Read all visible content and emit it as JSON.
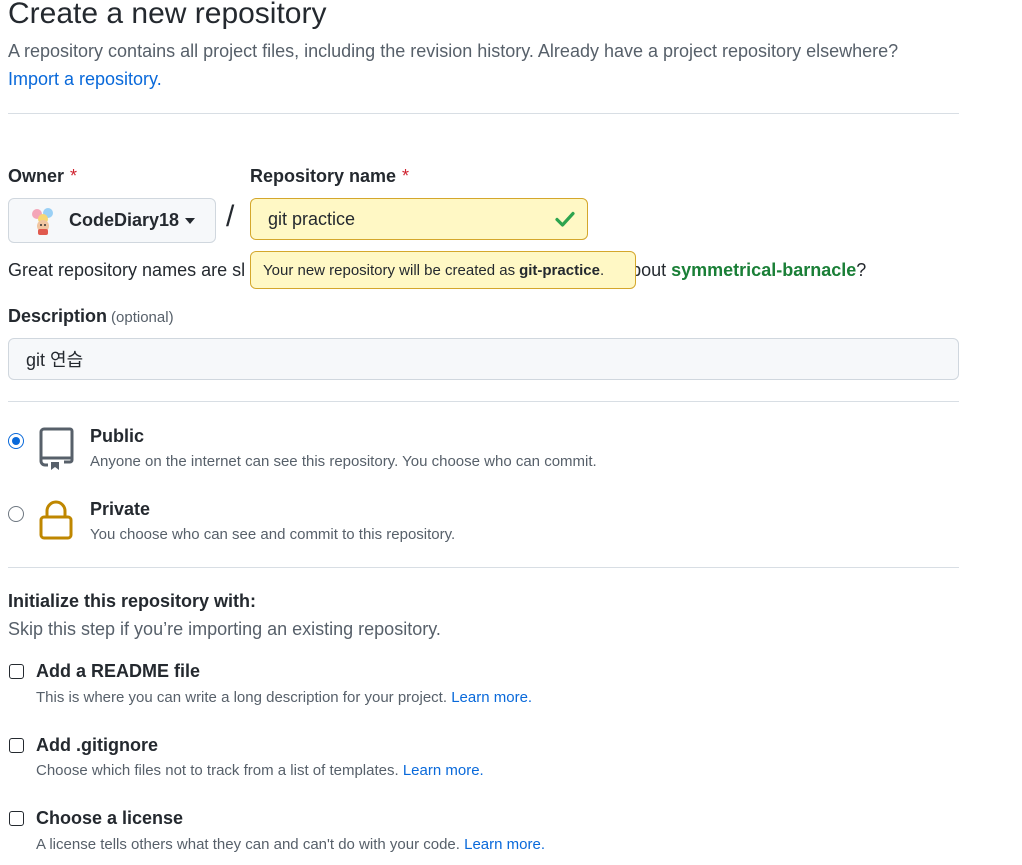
{
  "header": {
    "title": "Create a new repository",
    "subtitle": "A repository contains all project files, including the revision history. Already have a project repository elsewhere?",
    "import_link": "Import a repository."
  },
  "owner": {
    "label": "Owner",
    "required_mark": "*",
    "value": "CodeDiary18",
    "avatar_icon": "owner-avatar"
  },
  "separator": "/",
  "repo_name": {
    "label": "Repository name",
    "required_mark": "*",
    "value": "git practice",
    "status_icon": "check-icon",
    "status_color": "#2da44e"
  },
  "name_hint": {
    "prefix": "Great repository names are sl",
    "suffix": "bout ",
    "suggestion": "symmetrical-barnacle",
    "end": "?"
  },
  "tooltip": {
    "text": "Your new repository will be created as",
    "slug": "git-practice",
    "end": "."
  },
  "description": {
    "label": "Description",
    "optional": "(optional)",
    "value": "git 연습"
  },
  "visibility": {
    "options": [
      {
        "title": "Public",
        "desc": "Anyone on the internet can see this repository. You choose who can commit.",
        "selected": true,
        "icon": "repo-book-icon"
      },
      {
        "title": "Private",
        "desc": "You choose who can see and commit to this repository.",
        "selected": false,
        "icon": "lock-icon"
      }
    ]
  },
  "initialize": {
    "title": "Initialize this repository with:",
    "subtitle": "Skip this step if you’re importing an existing repository.",
    "options": [
      {
        "title": "Add a README file",
        "desc": "This is where you can write a long description for your project.",
        "link": "Learn more.",
        "checked": false
      },
      {
        "title": "Add .gitignore",
        "desc": "Choose which files not to track from a list of templates.",
        "link": "Learn more.",
        "checked": false
      },
      {
        "title": "Choose a license",
        "desc": "A license tells others what they can and can't do with your code.",
        "link": "Learn more.",
        "checked": false
      }
    ]
  },
  "colors": {
    "link": "#0969da",
    "suggestion": "#1a7f37",
    "required": "#cf222e",
    "radio_selected": "#0969da",
    "lock": "#bf8700"
  }
}
